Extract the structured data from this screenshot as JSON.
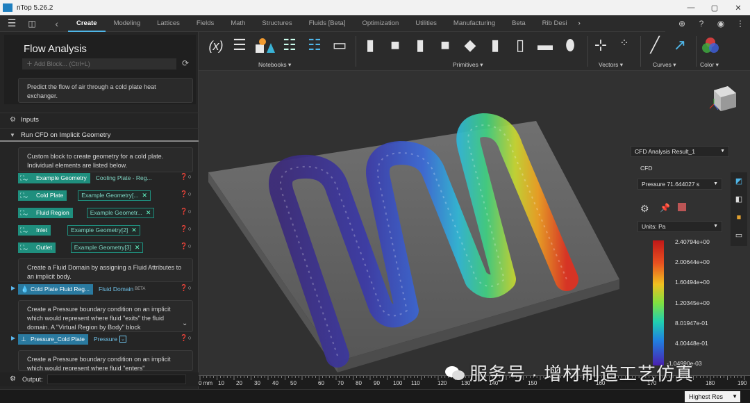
{
  "window": {
    "title": "nTop 5.26.2",
    "buttons": {
      "minimize": "—",
      "maximize": "▢",
      "close": "✕"
    }
  },
  "menu": {
    "tabs": [
      "Create",
      "Modeling",
      "Lattices",
      "Fields",
      "Math",
      "Structures",
      "Fluids [Beta]",
      "Optimization",
      "Utilities",
      "Manufacturing",
      "Beta",
      "Rib Desi"
    ],
    "active_tab": "Create"
  },
  "notebook": {
    "title": "Flow Analysis",
    "add_block_placeholder": "Add Block... (Ctrl+L)",
    "description": "Predict the flow of air through a cold plate heat exchanger.",
    "inputs_label": "Inputs",
    "section_title": "Run CFD on Implicit Geometry",
    "section_desc": "Custom block to create geometry for a cold plate. Individual elements are listed below.",
    "params": [
      {
        "name": "Example Geometry",
        "value": "Cooling Plate - Reg...",
        "type": "plain"
      },
      {
        "name": "Cold Plate",
        "value": "Example Geometry[...",
        "type": "ref"
      },
      {
        "name": "Fluid Region",
        "value": "Example Geometr...",
        "type": "ref"
      },
      {
        "name": "Inlet",
        "value": "Example Geometry[2]",
        "type": "ref"
      },
      {
        "name": "Outlet",
        "value": "Example Geometry[3]",
        "type": "ref"
      }
    ],
    "fluid_desc": "Create a Fluid Domain by assigning a Fluid Attributes to an implicit body.",
    "fluid_block": {
      "name": "Cold Plate Fluid Reg...",
      "type": "Fluid Domain",
      "badge": "BETA"
    },
    "pressure_desc": "Create a Pressure boundary condition on an implicit which would represent where fluid \"exits\" the fluid domain. A \"Virtual Region by Body\" block",
    "pressure_block": {
      "name": "Pressure_Cold Plate",
      "type": "Pressure"
    },
    "pressure2_desc": "Create a Pressure boundary condition on an implicit which would represent where fluid \"enters\"",
    "output_label": "Output:"
  },
  "ribbon": {
    "groups": [
      "Notebooks",
      "Primitives",
      "Vectors",
      "Curves",
      "Color"
    ]
  },
  "result": {
    "dataset": "CFD Analysis Result_1",
    "category": "CFD",
    "field": "Pressure 71.644027 s",
    "units": "Units: Pa",
    "legend": [
      "2.40794e+00",
      "2.00644e+00",
      "1.60494e+00",
      "1.20345e+00",
      "8.01947e-01",
      "4.00448e-01",
      "-1.04990e-03"
    ]
  },
  "ruler": {
    "unit_label": "0 mm",
    "ticks": [
      "10",
      "20",
      "30",
      "40",
      "50",
      "60",
      "70",
      "80",
      "90",
      "100",
      "110",
      "120",
      "130",
      "140",
      "150",
      "160",
      "170",
      "180",
      "190"
    ]
  },
  "status": {
    "resolution": "Highest Res"
  },
  "watermark": "服务号 · 增材制造工艺仿真",
  "colors": {
    "accent": "#4fb6e8",
    "chip": "#1f8f7e",
    "block_blue": "#2a7aa0"
  }
}
